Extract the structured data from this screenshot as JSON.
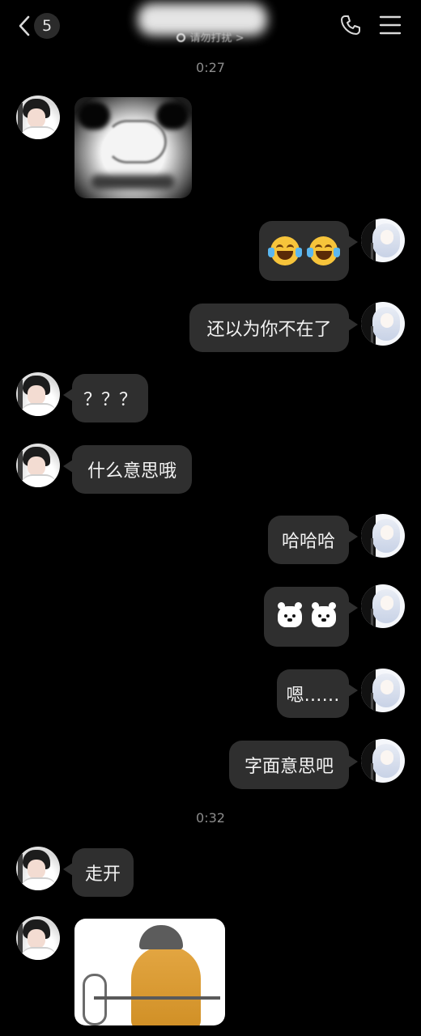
{
  "header": {
    "unread_count": "5",
    "dnd_status": "请勿打扰 >"
  },
  "timestamps": [
    "0:27",
    "0:32"
  ],
  "messages": [
    {
      "side": "left",
      "type": "sticker",
      "sticker": "panda-swirl-face"
    },
    {
      "side": "right",
      "type": "emoji",
      "emoji": [
        "😂",
        "😂"
      ]
    },
    {
      "side": "right",
      "type": "text",
      "text": "还以为你不在了"
    },
    {
      "side": "left",
      "type": "text",
      "text": "？？？"
    },
    {
      "side": "left",
      "type": "text",
      "text": "什么意思哦"
    },
    {
      "side": "right",
      "type": "text",
      "text": "哈哈哈"
    },
    {
      "side": "right",
      "type": "emoji",
      "emoji": [
        "bear-face",
        "bear-face"
      ]
    },
    {
      "side": "right",
      "type": "text",
      "text": "嗯……"
    },
    {
      "side": "right",
      "type": "text",
      "text": "字面意思吧"
    },
    {
      "side": "left",
      "type": "text",
      "text": "走开"
    },
    {
      "side": "left",
      "type": "sticker",
      "sticker": "doge-with-hat"
    }
  ],
  "colors": {
    "background": "#000000",
    "bubble": "#2f2f2f",
    "timestamp": "#8c8c8c",
    "text": "#f2f2f2"
  }
}
